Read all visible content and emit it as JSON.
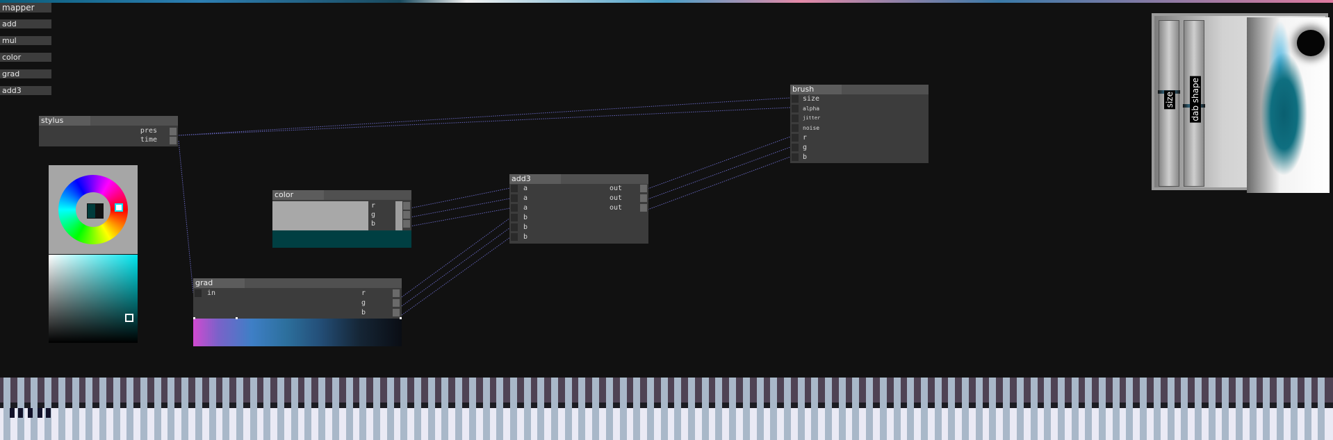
{
  "app": {
    "title": "mapper"
  },
  "menu": {
    "items": [
      {
        "label": "add"
      },
      {
        "label": "mul"
      },
      {
        "label": "color"
      },
      {
        "label": "grad"
      },
      {
        "label": "add3"
      }
    ]
  },
  "nodes": {
    "stylus": {
      "title": "stylus",
      "outputs": [
        "pres",
        "time"
      ]
    },
    "brush": {
      "title": "brush",
      "inputs": [
        "size",
        "alpha",
        "jitter",
        "noise",
        "r",
        "g",
        "b"
      ]
    },
    "add3": {
      "title": "add3",
      "inputs": [
        "a",
        "a",
        "a",
        "b",
        "b",
        "b"
      ],
      "outputs": [
        "out",
        "out",
        "out"
      ]
    },
    "color": {
      "title": "color",
      "outputs": [
        "r",
        "g",
        "b"
      ],
      "value": "#003f42"
    },
    "grad": {
      "title": "grad",
      "inputs": [
        "in"
      ],
      "outputs": [
        "r",
        "g",
        "b"
      ]
    }
  },
  "picker": {
    "selected_color": "#003b3b",
    "hue_color": "#00e5ee"
  },
  "preview": {
    "sliders": [
      {
        "label": "size"
      },
      {
        "label": "dab shape"
      }
    ]
  },
  "colors": {
    "background": "#111111",
    "node_body": "#3c3c3c",
    "wire": "#6f6fd0",
    "keyboard_upper": "#4f4354",
    "keyboard_lower": "#eaeaf5"
  }
}
